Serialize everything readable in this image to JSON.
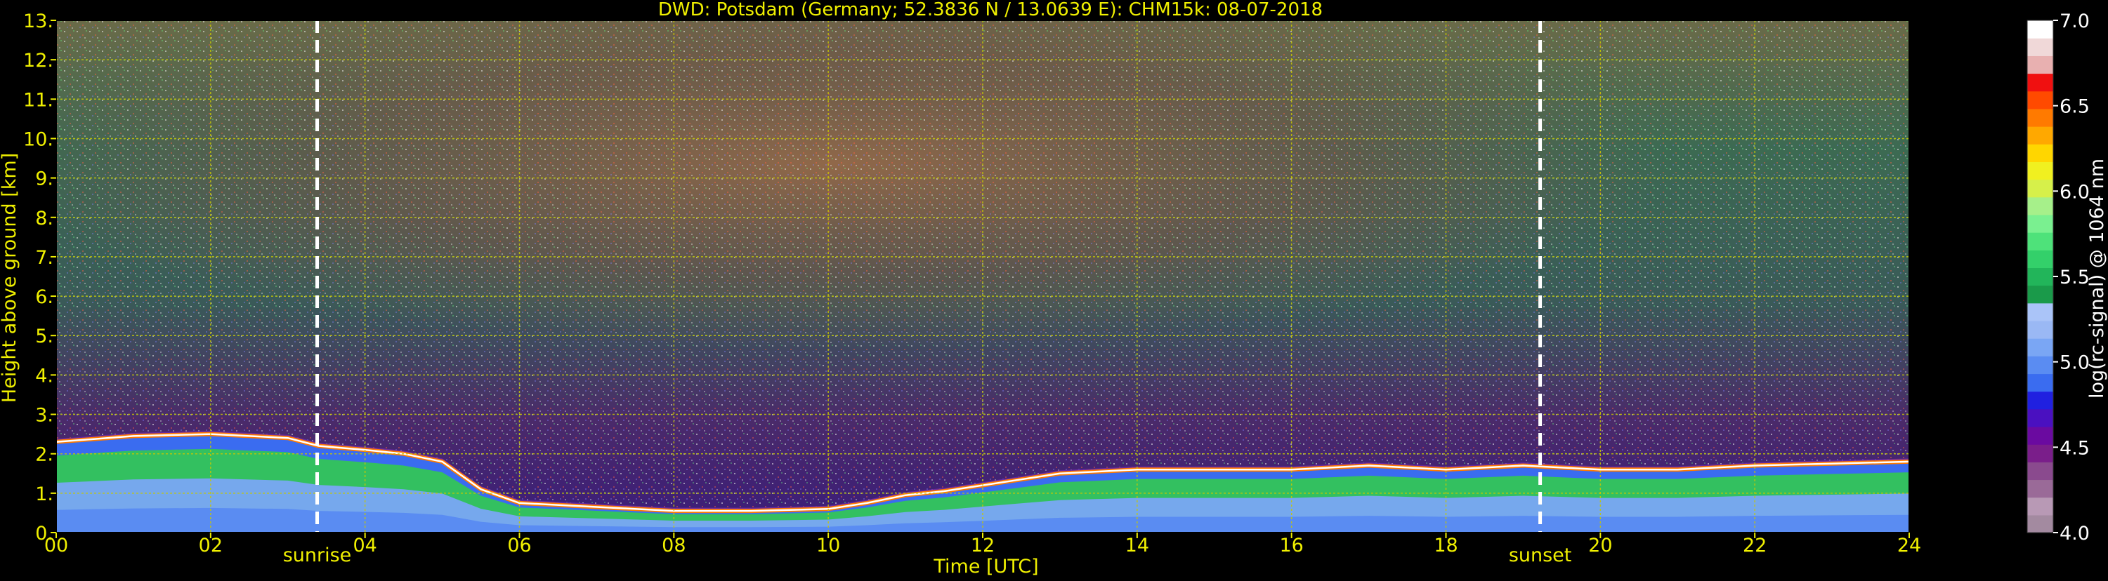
{
  "chart_data": {
    "type": "heatmap",
    "title": "DWD: Potsdam (Germany; 52.3836 N / 13.0639 E):    CHM15k: 08-07-2018",
    "xlabel": "Time [UTC]",
    "ylabel": "Height above ground [km]",
    "xlim": [
      0,
      24
    ],
    "ylim": [
      0,
      13
    ],
    "x_ticks": [
      "00",
      "02",
      "04",
      "06",
      "08",
      "10",
      "12",
      "14",
      "16",
      "18",
      "20",
      "22",
      "24"
    ],
    "y_ticks": [
      "0.",
      "1.",
      "2.",
      "3.",
      "4.",
      "5.",
      "6.",
      "7.",
      "8.",
      "9.",
      "10.",
      "11.",
      "12.",
      "13."
    ],
    "grid": true,
    "annotations": [
      {
        "label": "sunrise",
        "time": 3.38
      },
      {
        "label": "sunset",
        "time": 19.22
      }
    ],
    "boundary_layer_top_km": {
      "x": [
        0,
        1,
        2,
        3,
        3.4,
        4,
        4.5,
        5,
        5.5,
        6,
        7,
        8,
        9,
        10,
        10.5,
        11,
        11.5,
        12,
        12.5,
        13,
        14,
        15,
        16,
        17,
        18,
        19,
        20,
        21,
        22,
        23,
        24
      ],
      "y": [
        2.3,
        2.45,
        2.5,
        2.4,
        2.2,
        2.1,
        2.0,
        1.8,
        1.1,
        0.75,
        0.65,
        0.55,
        0.55,
        0.6,
        0.75,
        0.95,
        1.05,
        1.2,
        1.35,
        1.5,
        1.6,
        1.6,
        1.6,
        1.7,
        1.6,
        1.7,
        1.6,
        1.6,
        1.7,
        1.75,
        1.8
      ]
    },
    "colorbar": {
      "label": "log(rc-signal) @ 1064 nm",
      "range": [
        4.0,
        7.0
      ],
      "ticks": [
        "4.0",
        "4.5",
        "5.0",
        "5.5",
        "6.0",
        "6.5",
        "7.0"
      ],
      "colors": [
        "#a38aa0",
        "#b899b5",
        "#9a6a98",
        "#8a4a8e",
        "#7a1e8a",
        "#6a0aa0",
        "#4a10c0",
        "#2020e0",
        "#3a6cf0",
        "#5a8cf2",
        "#7aa6f4",
        "#9ab8f4",
        "#aac4f8",
        "#1a9a4a",
        "#22b55a",
        "#33d06a",
        "#4ee27a",
        "#7af090",
        "#a6f08a",
        "#d6f04a",
        "#f0f020",
        "#ffd600",
        "#ffa800",
        "#ff7a00",
        "#ff4a00",
        "#f01010",
        "#e8b0b0",
        "#f0d8d8",
        "#ffffff"
      ]
    }
  },
  "colors": {
    "background": "#000000",
    "text": "#f0f000",
    "grid": "#c8c800",
    "marker": "#ffffff",
    "colorbar_text": "#ffffff"
  }
}
